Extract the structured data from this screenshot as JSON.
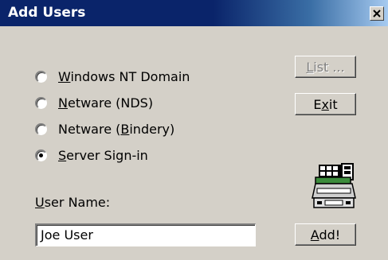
{
  "window": {
    "title": "Add Users",
    "close_glyph": "×"
  },
  "options": [
    {
      "label": "Windows NT Domain",
      "mnemonic_index": 0,
      "selected": false
    },
    {
      "label": "Netware (NDS)",
      "mnemonic_index": 0,
      "selected": false
    },
    {
      "label": "Netware (Bindery)",
      "mnemonic_index": 9,
      "selected": false
    },
    {
      "label": "Server Sign-in",
      "mnemonic_index": 0,
      "selected": true
    }
  ],
  "buttons": {
    "list": {
      "label": "List ...",
      "mnemonic_index": 0,
      "enabled": false
    },
    "exit": {
      "label": "Exit",
      "mnemonic_index": 1,
      "enabled": true
    },
    "add": {
      "label": "Add!",
      "mnemonic_index": 0,
      "enabled": true
    }
  },
  "user_name": {
    "label": "User Name:",
    "mnemonic_index": 0,
    "value": "Joe User"
  },
  "icons": {
    "close": "close-icon",
    "server": "server-icon"
  },
  "colors": {
    "title_bar": "#0a246a",
    "face": "#d4d0c8"
  }
}
